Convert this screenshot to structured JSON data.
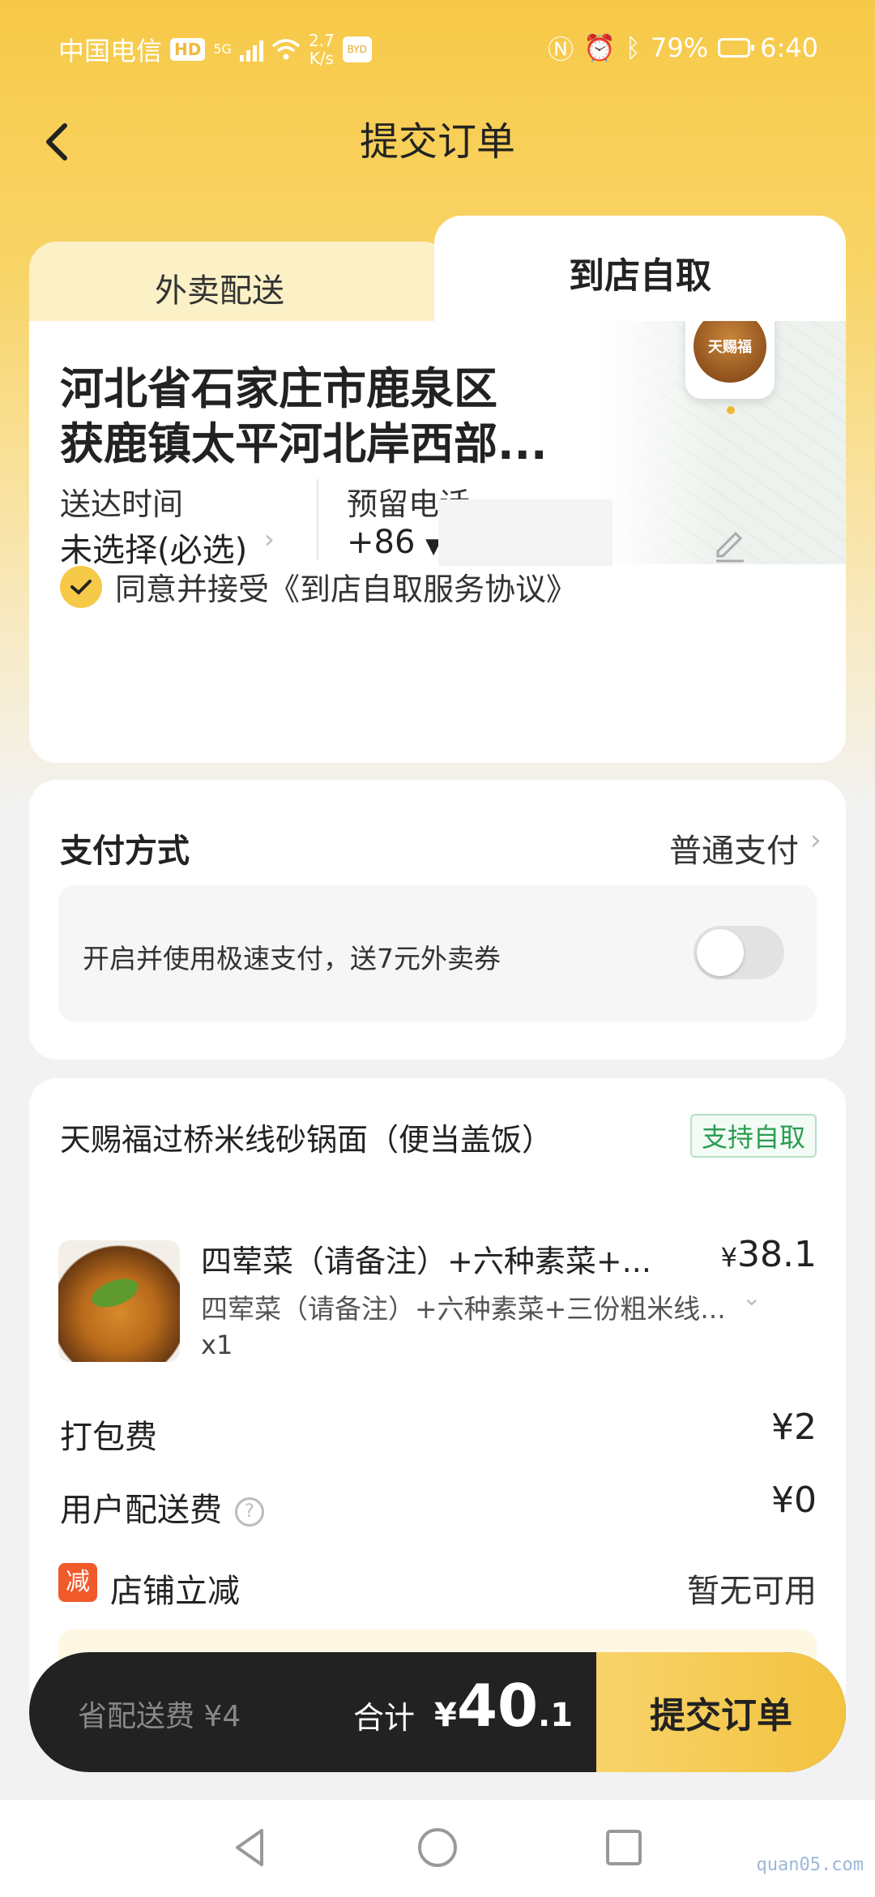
{
  "status_bar": {
    "carrier": "中国电信",
    "hd": "HD",
    "network": "5G",
    "speed_value": "2.7",
    "speed_unit": "K/s",
    "app_icon": "BYD",
    "battery": "79%",
    "time": "6:40",
    "icons": [
      "nfc-icon",
      "alarm-icon",
      "bluetooth-icon"
    ]
  },
  "header": {
    "title": "提交订单"
  },
  "tabs": [
    {
      "label": "外卖配送",
      "selected": false
    },
    {
      "label": "到店自取",
      "selected": true
    }
  ],
  "store_logo_text": "天赐福",
  "address": {
    "line1": "河北省石家庄市鹿泉区",
    "line2": "获鹿镇太平河北岸西部..."
  },
  "delivery": {
    "time_label": "送达时间",
    "time_value": "未选择(必选)",
    "phone_label": "预留电话",
    "phone_prefix": "+86"
  },
  "agreement": {
    "text": "同意并接受《到店自取服务协议》",
    "checked": true
  },
  "payment": {
    "title": "支付方式",
    "method": "普通支付",
    "fast_pay_text": "开启并使用极速支付，送7元外卖券",
    "fast_pay_enabled": false
  },
  "shop": {
    "name": "天赐福过桥米线砂锅面（便当盖饭）",
    "badge": "支持自取"
  },
  "item": {
    "name": "四荤菜（请备注）+六种素菜+...",
    "price_symbol": "¥",
    "price": "38.1",
    "desc": "四荤菜（请备注）+六种素菜+三份粗米线...",
    "qty": "x1"
  },
  "fees": {
    "packing_label": "打包费",
    "packing_value": "¥2",
    "delivery_label": "用户配送费",
    "delivery_value": "¥0",
    "discount_badge": "减",
    "discount_label": "店铺立减",
    "discount_value": "暂无可用"
  },
  "bottom_bar": {
    "save_text": "省配送费 ¥4",
    "total_label": "合计",
    "currency": "¥",
    "total_int": "40",
    "total_dec": ".1",
    "submit": "提交订单"
  },
  "watermark": "quan05.com",
  "colors": {
    "accent": "#f7c948",
    "badge_green": "#2a9c52",
    "discount_red": "#f15a2b",
    "bar_dark": "#222222"
  }
}
